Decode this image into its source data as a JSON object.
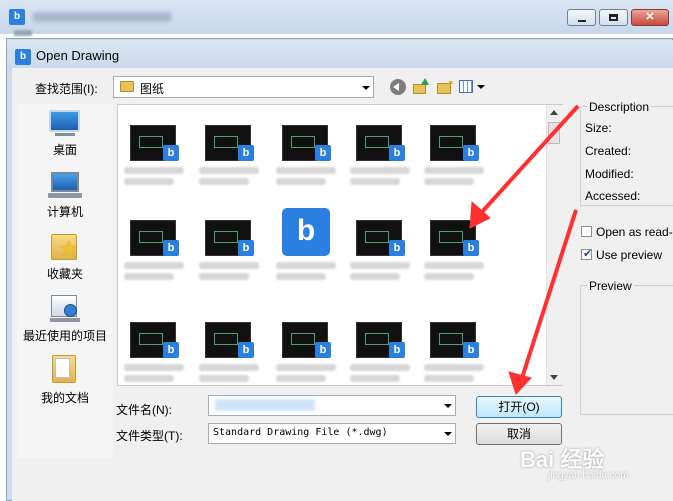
{
  "outer_window": {
    "title_blurred": true
  },
  "dialog": {
    "title": "Open Drawing"
  },
  "toolbar": {
    "lookin_label": "查找范围(I):",
    "lookin_value": "图纸"
  },
  "places": [
    {
      "label": "桌面",
      "icon": "desktop-icon"
    },
    {
      "label": "计算机",
      "icon": "computer-icon"
    },
    {
      "label": "收藏夹",
      "icon": "favorites-star-icon"
    },
    {
      "label": "最近使用的项目",
      "icon": "recent-items-icon"
    },
    {
      "label": "我的文档",
      "icon": "documents-folder-icon"
    }
  ],
  "file_list": {
    "row_count": 3,
    "items_per_row": 5,
    "badge_letter": "b",
    "accent": "#2b7fe0"
  },
  "fields": {
    "filename_label": "文件名(N):",
    "filetype_label": "文件类型(T):",
    "filetype_value": "Standard Drawing File (*.dwg)"
  },
  "buttons": {
    "open": "打开(O)",
    "cancel": "取消"
  },
  "description": {
    "legend": "Description",
    "size": "Size:",
    "created": "Created:",
    "modified": "Modified:",
    "accessed": "Accessed:"
  },
  "options": {
    "open_readonly": "Open as read-or",
    "open_readonly_checked": false,
    "use_preview": "Use preview",
    "use_preview_checked": true
  },
  "preview": {
    "legend": "Preview"
  },
  "watermark": {
    "text": "Bai 经验",
    "url": "jingyan.baidu.com"
  },
  "colors": {
    "annotation_arrow": "#ff3030"
  }
}
